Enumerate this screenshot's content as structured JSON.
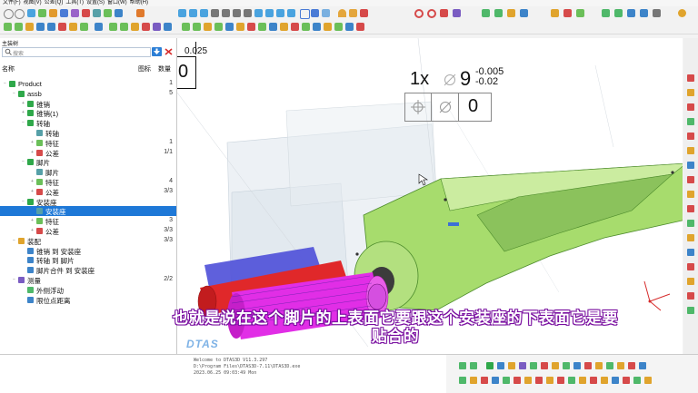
{
  "menu": [
    "文件(F)",
    "视图(V)",
    "公差(Q)",
    "工具(T)",
    "设置(S)",
    "窗口(W)",
    "帮助(H)"
  ],
  "panel": {
    "title": "主装树",
    "search_placeholder": "搜索",
    "col_name": "名称",
    "col_icon": "图标",
    "col_count": "数量"
  },
  "tree": [
    {
      "label": "Product",
      "count": "1"
    },
    {
      "label": "assb",
      "count": "5"
    },
    {
      "label": "锥销",
      "count": ""
    },
    {
      "label": "锥销(1)",
      "count": ""
    },
    {
      "label": "转轴",
      "count": ""
    },
    {
      "label": "转轴",
      "count": ""
    },
    {
      "label": "特征",
      "count": "1"
    },
    {
      "label": "公差",
      "count": "1/1"
    },
    {
      "label": "脚片",
      "count": ""
    },
    {
      "label": "脚片",
      "count": ""
    },
    {
      "label": "特征",
      "count": "4"
    },
    {
      "label": "公差",
      "count": "3/3"
    },
    {
      "label": "安装座",
      "count": ""
    },
    {
      "label": "安装座",
      "count": ""
    },
    {
      "label": "特征",
      "count": "3"
    },
    {
      "label": "公差",
      "count": "3/3"
    },
    {
      "label": "装配",
      "count": "3/3"
    },
    {
      "label": "锥销 到 安装座",
      "count": ""
    },
    {
      "label": "转轴 到 脚片",
      "count": ""
    },
    {
      "label": "脚片合件 到 安装座",
      "count": ""
    },
    {
      "label": "测量",
      "count": "2/2"
    },
    {
      "label": "外侧浮动",
      "count": ""
    },
    {
      "label": "限位点距离",
      "count": ""
    }
  ],
  "fcf_left": {
    "tol": "0.025",
    "datum": "0"
  },
  "fcf_main": {
    "count": "1x",
    "nominal": "9",
    "upper": "-0.005",
    "lower": "-0.02",
    "tol": "0"
  },
  "subtitle": {
    "line1": "也就是说在这个脚片的上表面它要跟这个安装座的下表面它是要",
    "line2": "贴合的"
  },
  "watermark": "DTAS",
  "console": [
    "Welcome  to  DTAS3D  V11.3.297",
    "D:\\Program  Files\\DTAS3D-7.11\\DTAS3D.exe",
    "2023.06.25  09:03:49  Mon"
  ],
  "colors": {
    "selection": "#1e78d7",
    "part_green": "#9fd86a",
    "cylinder_magenta": "#e12ee6",
    "cylinder_red": "#e0282a",
    "cylinder_blue": "#4e4fd8",
    "subtitle_outline": "#7a0fa0"
  }
}
